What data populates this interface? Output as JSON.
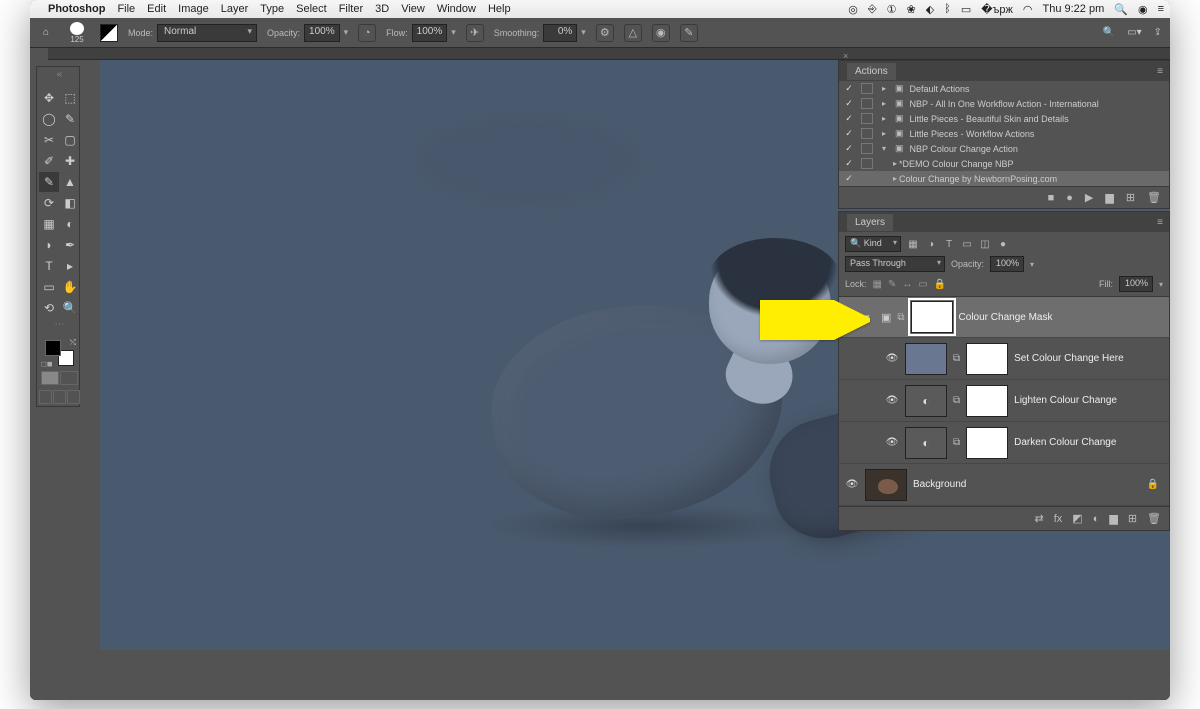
{
  "menubar": {
    "app_name": "Photoshop",
    "menus": [
      "File",
      "Edit",
      "Image",
      "Layer",
      "Type",
      "Select",
      "Filter",
      "3D",
      "View",
      "Window",
      "Help"
    ],
    "clock": "Thu 9:22 pm"
  },
  "options": {
    "brush_size": "125",
    "mode_label": "Mode:",
    "mode_value": "Normal",
    "opacity_label": "Opacity:",
    "opacity_value": "100%",
    "flow_label": "Flow:",
    "flow_value": "100%",
    "smoothing_label": "Smoothing:",
    "smoothing_value": "0%"
  },
  "tools": [
    "↔",
    "⬚",
    "◯",
    "✎",
    "⊹",
    "✂",
    "✐",
    "▢",
    "◐",
    "⎘",
    "⌖",
    "△",
    "✚",
    "⟳",
    "✎",
    "⌀",
    "◧",
    "⬚",
    "▲",
    "✒",
    "T",
    "▸",
    "✋",
    "□",
    "🔍",
    "⋯"
  ],
  "actions_panel": {
    "title": "Actions",
    "rows": [
      {
        "chk": true,
        "dlg": true,
        "disc": "▸",
        "folder": true,
        "name": "Default Actions",
        "indent": 0
      },
      {
        "chk": true,
        "dlg": true,
        "disc": "▸",
        "folder": true,
        "name": "NBP - All In One Workflow Action - International",
        "indent": 0
      },
      {
        "chk": true,
        "dlg": true,
        "disc": "▸",
        "folder": true,
        "name": "Little Pieces - Beautiful Skin and Details",
        "indent": 0
      },
      {
        "chk": true,
        "dlg": true,
        "disc": "▸",
        "folder": true,
        "name": "Little Pieces - Workflow Actions",
        "indent": 0
      },
      {
        "chk": true,
        "dlg": true,
        "disc": "▾",
        "folder": true,
        "name": "NBP Colour Change Action",
        "indent": 0
      },
      {
        "chk": true,
        "dlg": true,
        "disc": "▸",
        "folder": false,
        "name": "*DEMO Colour Change NBP",
        "indent": 1
      },
      {
        "chk": true,
        "dlg": false,
        "disc": "▸",
        "folder": false,
        "name": "Colour Change by NewbornPosing.com",
        "indent": 1,
        "sel": true
      }
    ],
    "foot_icons": [
      "■",
      "●",
      "▶",
      "▆",
      "⊞",
      "🗑"
    ]
  },
  "layers_panel": {
    "title": "Layers",
    "kind_label": "Kind",
    "filter_icons": [
      "▦",
      "◑",
      "T",
      "▭",
      "◫",
      "●"
    ],
    "blend_mode": "Pass Through",
    "opacity_label": "Opacity:",
    "opacity_value": "100%",
    "lock_label": "Lock:",
    "lock_icons": [
      "▦",
      "✎",
      "↔",
      "▭",
      "🔒"
    ],
    "fill_label": "Fill:",
    "fill_value": "100%",
    "layers": [
      {
        "type": "group",
        "name": "Colour Change Mask",
        "sel": true,
        "mask": true
      },
      {
        "type": "solidfill",
        "name": "Set Colour Change Here",
        "indent": 1,
        "mask": true
      },
      {
        "type": "adjustment",
        "name": "Lighten Colour Change",
        "indent": 1,
        "mask": true
      },
      {
        "type": "adjustment",
        "name": "Darken Colour Change",
        "indent": 1,
        "mask": true
      },
      {
        "type": "pixel",
        "name": "Background",
        "locked": true
      }
    ],
    "foot_icons": [
      "⇄",
      "fx",
      "◩",
      "◐",
      "▆",
      "⊞",
      "🗑"
    ]
  },
  "arrow_color": "#ffee00"
}
